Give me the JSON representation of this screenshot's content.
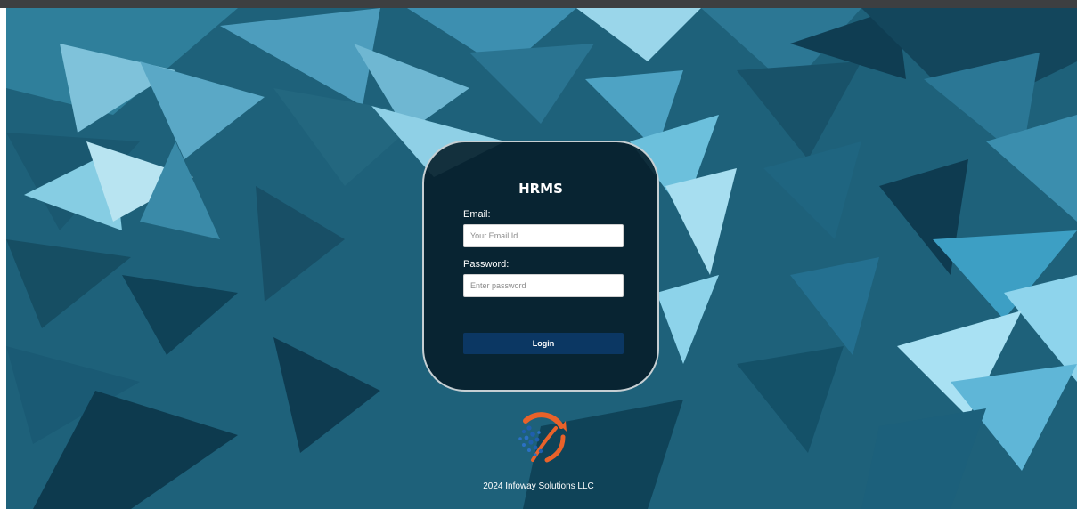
{
  "app": {
    "title": "HRMS"
  },
  "login": {
    "email_label": "Email:",
    "email_placeholder": "Your Email Id",
    "password_label": "Password:",
    "password_placeholder": "Enter password",
    "login_button": "Login"
  },
  "footer": {
    "text": "2024 Infoway Solutions LLC"
  },
  "colors": {
    "background": "#1d5f78",
    "card": "#061e2a",
    "button": "#0b3763",
    "logo_orange": "#e9622a",
    "logo_blue": "#1f5fae"
  },
  "icons": {
    "brand_logo": "infoway-globe-logo"
  }
}
